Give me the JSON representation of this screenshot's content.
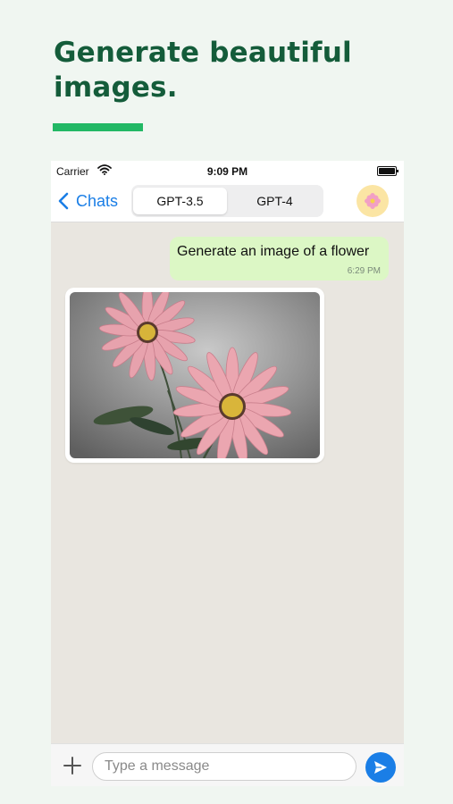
{
  "promo": {
    "headline": "Generate beautiful images.",
    "accent_color": "#22b865",
    "headline_color": "#145c3a"
  },
  "status_bar": {
    "carrier": "Carrier",
    "time": "9:09 PM",
    "wifi_icon": "wifi-icon",
    "battery_icon": "battery-icon"
  },
  "nav": {
    "back_label": "Chats",
    "back_icon": "chevron-left-icon",
    "segments": [
      {
        "label": "GPT-3.5",
        "selected": true
      },
      {
        "label": "GPT-4",
        "selected": false
      }
    ],
    "avatar_icon": "flower-avatar-icon"
  },
  "chat": {
    "messages": [
      {
        "from": "user",
        "text": "Generate an image of a flower",
        "time": "6:29 PM",
        "bubble_color": "#dcf7c5"
      },
      {
        "from": "assistant",
        "type": "image",
        "image": "pink-daisies-image"
      }
    ]
  },
  "composer": {
    "placeholder": "Type a message",
    "value": "",
    "add_icon": "plus-icon",
    "send_icon": "send-icon",
    "send_color": "#1a7ee6"
  }
}
